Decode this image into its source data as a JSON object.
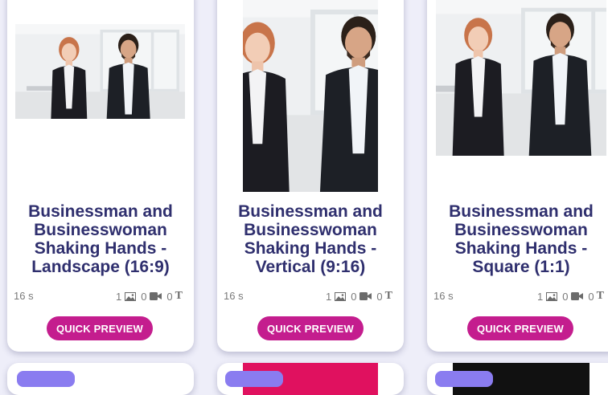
{
  "cards": [
    {
      "title": "Businessman and Businesswoman Shaking Hands - Landscape (16:9)",
      "duration": "16 s",
      "images": "1",
      "videos": "0",
      "texts": "0",
      "button": "QUICK PREVIEW"
    },
    {
      "title": "Businessman and Businesswoman Shaking Hands - Vertical (9:16)",
      "duration": "16 s",
      "images": "1",
      "videos": "0",
      "texts": "0",
      "button": "QUICK PREVIEW"
    },
    {
      "title": "Businessman and Businesswoman Shaking Hands - Square (1:1)",
      "duration": "16 s",
      "images": "1",
      "videos": "0",
      "texts": "0",
      "button": "QUICK PREVIEW"
    }
  ],
  "icons": {
    "image": "image-icon",
    "video": "video-camera-icon",
    "text": "text-icon"
  },
  "colors": {
    "background": "#eeeef9",
    "title": "#2f2f6e",
    "button": "#c41d8e",
    "meta": "#7a7a7a",
    "chip": "#8a7cf0"
  }
}
